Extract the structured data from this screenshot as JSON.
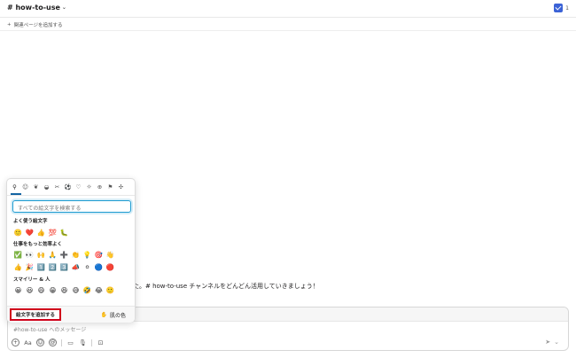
{
  "header": {
    "channel_name": "# how-to-use",
    "member_count": "1"
  },
  "bookmarks": {
    "add_label": "関連ページを追加する"
  },
  "message": {
    "text": "た。# how-to-use チャンネルをどんどん活用していきましょう！"
  },
  "composer": {
    "placeholder": "#how-to-use へのメッセージ"
  },
  "emoji_picker": {
    "search_placeholder": "すべての絵文字を検索する",
    "sections": [
      {
        "title": "よく使う絵文字",
        "emojis": [
          "🙂",
          "❤️",
          "👍",
          "💯",
          "🐛"
        ]
      },
      {
        "title": "仕事をもっと効率よく",
        "rows": [
          [
            "✅",
            "👀",
            "🙌",
            "🙏",
            "➕",
            "👏",
            "💡",
            "🎯",
            "👋"
          ],
          [
            "👍",
            "🎉",
            "1️⃣",
            "2️⃣",
            "3️⃣",
            "📣",
            "⚪",
            "🔵",
            "🔴"
          ]
        ]
      },
      {
        "title": "スマイリー & 人",
        "emojis": [
          "😀",
          "😃",
          "😄",
          "😁",
          "😆",
          "😅",
          "🤣",
          "😂",
          "🙂"
        ]
      }
    ],
    "add_emoji_label": "絵文字を追加する",
    "skin_tone_label": "肌の色",
    "skin_tone_icon": "✋"
  }
}
